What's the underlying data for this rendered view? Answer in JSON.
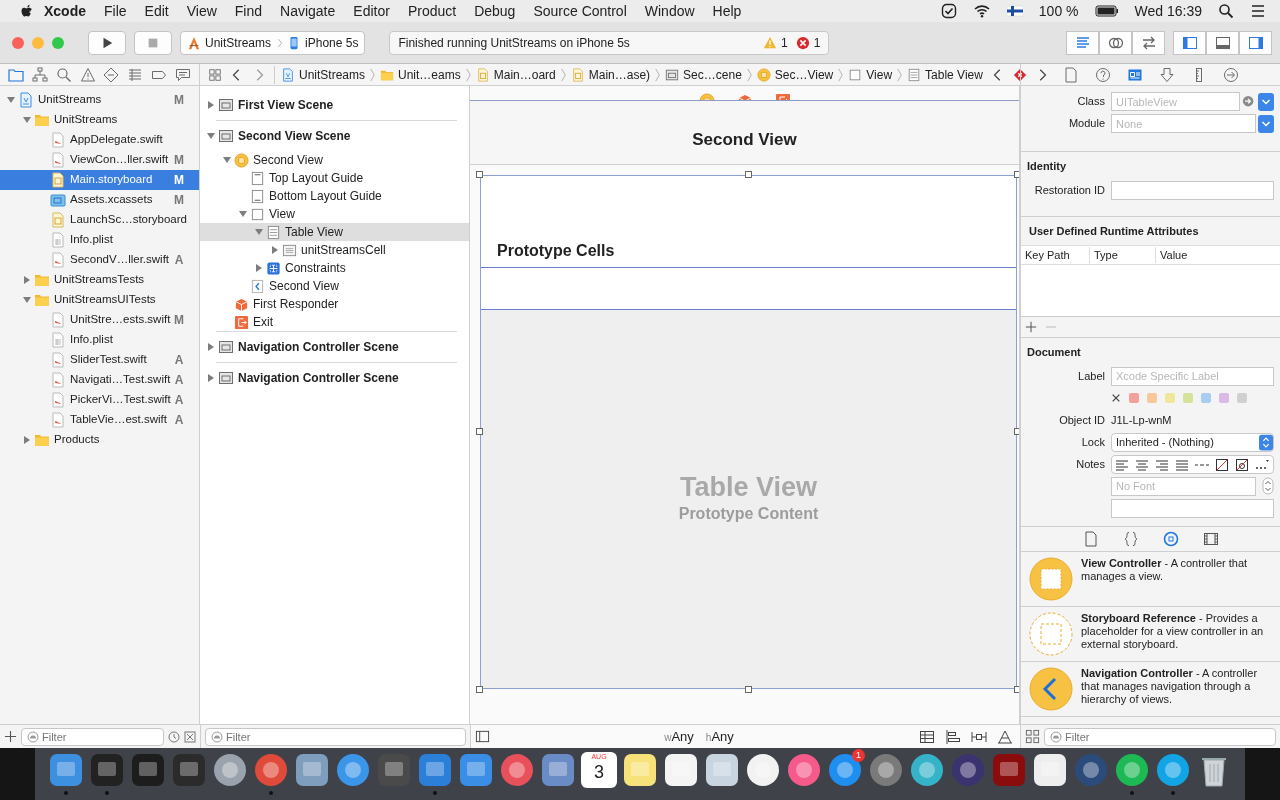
{
  "menu_bar": {
    "app": "Xcode",
    "menus": [
      "File",
      "Edit",
      "View",
      "Find",
      "Navigate",
      "Editor",
      "Product",
      "Debug",
      "Source Control",
      "Window",
      "Help"
    ],
    "battery": "100 %",
    "clock": "Wed 16:39"
  },
  "toolbar": {
    "scheme": "UnitStreams",
    "device": "iPhone 5s",
    "activity": "Finished running UnitStreams on iPhone 5s",
    "warnings": "1",
    "errors": "1",
    "editor_modes": [
      {
        "selected": true
      },
      {
        "selected": false
      },
      {
        "selected": false
      }
    ],
    "panels": [
      {
        "selected": true
      },
      {
        "selected": false
      },
      {
        "selected": true
      }
    ]
  },
  "navigator": {
    "tabs": [
      {
        "selected": true
      },
      {
        "selected": false
      },
      {
        "selected": false
      },
      {
        "selected": false
      },
      {
        "selected": false
      },
      {
        "selected": false
      },
      {
        "selected": false
      },
      {
        "selected": false
      }
    ],
    "tree": [
      {
        "label": "UnitStreams",
        "kind": "project",
        "badge": "M",
        "selected": false,
        "expanded": true,
        "children": [
          {
            "label": "UnitStreams",
            "kind": "folder",
            "selected": false,
            "expanded": true,
            "children": [
              {
                "label": "AppDelegate.swift",
                "kind": "swift",
                "selected": false
              },
              {
                "label": "ViewCon…ller.swift",
                "kind": "swift",
                "badge": "M",
                "selected": false
              },
              {
                "label": "Main.storyboard",
                "kind": "storyboard",
                "badge": "M",
                "selected": true
              },
              {
                "label": "Assets.xcassets",
                "kind": "assets",
                "badge": "M",
                "selected": false
              },
              {
                "label": "LaunchSc…storyboard",
                "kind": "storyboard",
                "selected": false
              },
              {
                "label": "Info.plist",
                "kind": "plist",
                "selected": false
              },
              {
                "label": "SecondV…ller.swift",
                "kind": "swift",
                "badge": "A",
                "selected": false
              }
            ]
          },
          {
            "label": "UnitStreamsTests",
            "kind": "folder",
            "selected": false,
            "expanded": false
          },
          {
            "label": "UnitStreamsUITests",
            "kind": "folder",
            "selected": false,
            "expanded": true,
            "children": [
              {
                "label": "UnitStre…ests.swift",
                "kind": "swift",
                "badge": "M",
                "selected": false
              },
              {
                "label": "Info.plist",
                "kind": "plist",
                "selected": false
              },
              {
                "label": "SliderTest.swift",
                "kind": "swift",
                "badge": "A",
                "selected": false
              },
              {
                "label": "Navigati…Test.swift",
                "kind": "swift",
                "badge": "A",
                "selected": false
              },
              {
                "label": "PickerVi…Test.swift",
                "kind": "swift",
                "badge": "A",
                "selected": false
              },
              {
                "label": "TableVie…est.swift",
                "kind": "swift",
                "badge": "A",
                "selected": false
              }
            ]
          },
          {
            "label": "Products",
            "kind": "folder",
            "selected": false,
            "expanded": false
          }
        ]
      }
    ],
    "filter": {
      "placeholder": "Filter"
    }
  },
  "jump_bar": {
    "crumbs": [
      {
        "label": "UnitStreams",
        "kind": "project"
      },
      {
        "label": "Unit…eams",
        "kind": "folder"
      },
      {
        "label": "Main…oard",
        "kind": "storyboard"
      },
      {
        "label": "Main…ase)",
        "kind": "storyboard"
      },
      {
        "label": "Sec…cene",
        "kind": "scene"
      },
      {
        "label": "Sec…View",
        "kind": "vc"
      },
      {
        "label": "View",
        "kind": "view"
      },
      {
        "label": "Table View",
        "kind": "table"
      }
    ]
  },
  "outline": {
    "items": [
      {
        "label": "First View Scene",
        "kind": "scene",
        "selected": false,
        "expanded": false
      },
      {
        "label": "Second View Scene",
        "kind": "scene",
        "selected": false,
        "expanded": true,
        "children": [
          {
            "label": "Second View",
            "kind": "vc",
            "selected": false,
            "expanded": true,
            "children": [
              {
                "label": "Top Layout Guide",
                "kind": "guide_top",
                "selected": false
              },
              {
                "label": "Bottom Layout Guide",
                "kind": "guide_bottom",
                "selected": false
              },
              {
                "label": "View",
                "kind": "view",
                "selected": false,
                "expanded": true,
                "children": [
                  {
                    "label": "Table View",
                    "kind": "table",
                    "selected": true,
                    "expanded": true,
                    "children": [
                      {
                        "label": "unitStreamsCell",
                        "kind": "cell",
                        "selected": false,
                        "expanded": false
                      }
                    ]
                  },
                  {
                    "label": "Constraints",
                    "kind": "constraints",
                    "selected": false,
                    "expanded": false
                  }
                ]
              },
              {
                "label": "Second View",
                "kind": "back",
                "selected": false
              }
            ]
          },
          {
            "label": "First Responder",
            "kind": "responder",
            "selected": false
          },
          {
            "label": "Exit",
            "kind": "exit",
            "selected": false
          }
        ]
      },
      {
        "label": "Navigation Controller Scene",
        "kind": "scene",
        "selected": false,
        "expanded": false
      },
      {
        "label": "Navigation Controller Scene",
        "kind": "scene",
        "selected": false,
        "expanded": false
      }
    ],
    "filter": {
      "placeholder": "Filter"
    }
  },
  "canvas": {
    "nav_title": "Second View",
    "section_header": "Prototype Cells",
    "placeholder_title": "Table View",
    "placeholder_subtitle": "Prototype Content",
    "size_classes": [
      {
        "prefix": "w",
        "value": "Any"
      },
      {
        "prefix": "h",
        "value": "Any"
      }
    ]
  },
  "inspector": {
    "tabs": [
      {
        "selected": false
      },
      {
        "selected": false
      },
      {
        "selected": true
      },
      {
        "selected": false
      },
      {
        "selected": false
      },
      {
        "selected": false
      }
    ],
    "class": {
      "label": "Class",
      "placeholder": "UITableView"
    },
    "module": {
      "label": "Module",
      "placeholder": "None"
    },
    "identity": {
      "title": "Identity",
      "restoration_label": "Restoration ID"
    },
    "runtime_attributes": {
      "title": "User Defined Runtime Attributes",
      "columns": [
        "Key Path",
        "Type",
        "Value"
      ]
    },
    "document": {
      "title": "Document",
      "label_label": "Label",
      "label_placeholder": "Xcode Specific Label",
      "label_colors": [
        {
          "color": "#f4a19d"
        },
        {
          "color": "#f7c79b"
        },
        {
          "color": "#f1e79b"
        },
        {
          "color": "#d5e29b"
        },
        {
          "color": "#a8cdf1"
        },
        {
          "color": "#dbb9e5"
        },
        {
          "color": "#d0d0d0"
        }
      ],
      "object_id_label": "Object ID",
      "object_id": "J1L-Lp-wnM",
      "lock_label": "Lock",
      "lock": "Inherited - (Nothing)",
      "notes_label": "Notes",
      "font_placeholder": "No Font"
    }
  },
  "library": {
    "tabs": [
      {
        "selected": false
      },
      {
        "selected": false
      },
      {
        "selected": true
      },
      {
        "selected": false
      }
    ],
    "items": [
      {
        "kind": "view_controller",
        "text": "**View Controller** - A controller that manages a view."
      },
      {
        "kind": "storyboard_reference",
        "text": "**Storyboard Reference** - Provides a placeholder for a view controller in an external storyboard."
      },
      {
        "kind": "navigation_controller",
        "text": "**Navigation Controller** - A controller that manages navigation through a hierarchy of views."
      }
    ],
    "filter": {
      "placeholder": "Filter"
    }
  },
  "dock": {
    "apps": [
      {
        "kind": "square",
        "color": "#3d8fe0",
        "running": true
      },
      {
        "kind": "square",
        "color": "#222222",
        "running": true
      },
      {
        "kind": "square",
        "color": "#1d1d1d",
        "running": false
      },
      {
        "kind": "square",
        "color": "#2b2b2b",
        "running": false
      },
      {
        "kind": "circle",
        "color": "#9aa3ad",
        "running": false
      },
      {
        "kind": "circle",
        "color": "#e04a3a",
        "running": true
      },
      {
        "kind": "square",
        "color": "#7f9dbd",
        "running": false
      },
      {
        "kind": "circle",
        "color": "#3b95e8",
        "running": false
      },
      {
        "kind": "square",
        "color": "#4a4a4a",
        "running": false
      },
      {
        "kind": "square",
        "color": "#2b7fd8",
        "running": true
      },
      {
        "kind": "square",
        "color": "#3a8ee6",
        "running": false
      },
      {
        "kind": "circle",
        "color": "#e8505b",
        "running": false
      },
      {
        "kind": "square",
        "color": "#6a8cc6",
        "running": false
      },
      {
        "kind": "calendar",
        "month": "AUG",
        "day": "3",
        "running": false
      },
      {
        "kind": "square",
        "color": "#f7e27a",
        "running": false
      },
      {
        "kind": "square",
        "color": "#f4f4f4",
        "running": false
      },
      {
        "kind": "square",
        "color": "#c8d5e0",
        "running": false
      },
      {
        "kind": "circle",
        "color": "#f2f2f2",
        "running": false
      },
      {
        "kind": "circle",
        "color": "#f65a8a",
        "running": false
      },
      {
        "kind": "circle",
        "color": "#1e8ef0",
        "badge": "1",
        "running": false
      },
      {
        "kind": "circle",
        "color": "#7a7a7a",
        "running": false
      },
      {
        "kind": "circle",
        "color": "#35b3c9",
        "running": false
      },
      {
        "kind": "circle",
        "color": "#3b3270",
        "running": false
      },
      {
        "kind": "square",
        "color": "#8b0c0c",
        "running": false
      },
      {
        "kind": "square",
        "color": "#eeeeee",
        "running": false
      },
      {
        "kind": "circle",
        "color": "#2b4c7a",
        "running": false
      },
      {
        "kind": "circle",
        "color": "#1db954",
        "running": true
      },
      {
        "kind": "circle",
        "color": "#12a5e6",
        "running": true
      },
      {
        "kind": "trash",
        "color": "#d0d4d8",
        "running": false
      }
    ]
  }
}
